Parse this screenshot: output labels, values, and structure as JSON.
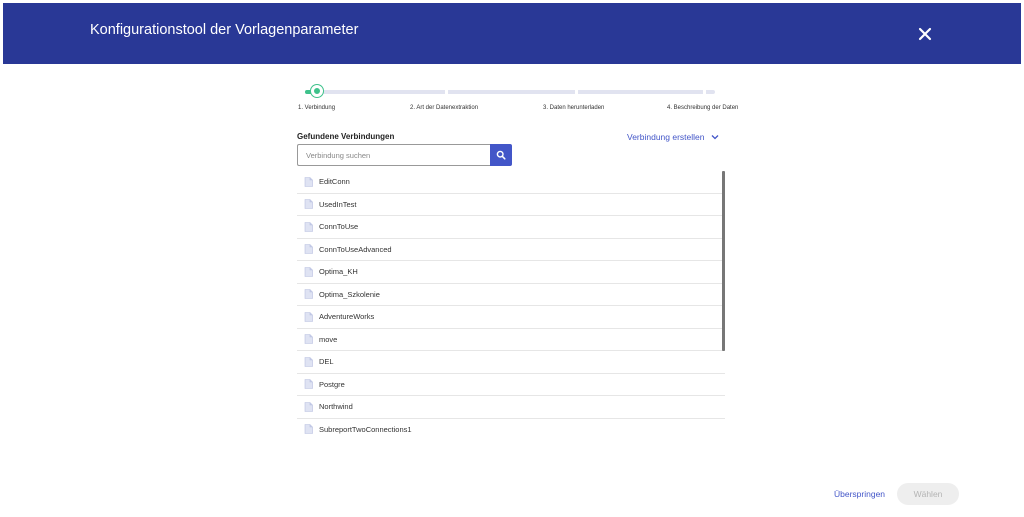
{
  "header": {
    "title": "Konfigurationstool der Vorlagenparameter"
  },
  "stepper": {
    "steps": [
      {
        "label": "1. Verbindung"
      },
      {
        "label": "2. Art der Datenextraktion"
      },
      {
        "label": "3. Daten herunterladen"
      },
      {
        "label": "4. Beschreibung der Daten"
      }
    ],
    "active_step": 1
  },
  "connections": {
    "title": "Gefundene Verbindungen",
    "create_label": "Verbindung erstellen",
    "search_placeholder": "Verbindung suchen",
    "items": [
      "EditConn",
      "UsedInTest",
      "ConnToUse",
      "ConnToUseAdvanced",
      "Optima_KH",
      "Optima_Szkolenie",
      "AdventureWorks",
      "move",
      "DEL",
      "Postgre",
      "Northwind",
      "SubreportTwoConnections1"
    ]
  },
  "footer": {
    "skip_label": "Überspringen",
    "choose_label": "Wählen"
  },
  "colors": {
    "header_bg": "#293896",
    "accent": "#4356c8",
    "progress": "#3ec28b"
  }
}
